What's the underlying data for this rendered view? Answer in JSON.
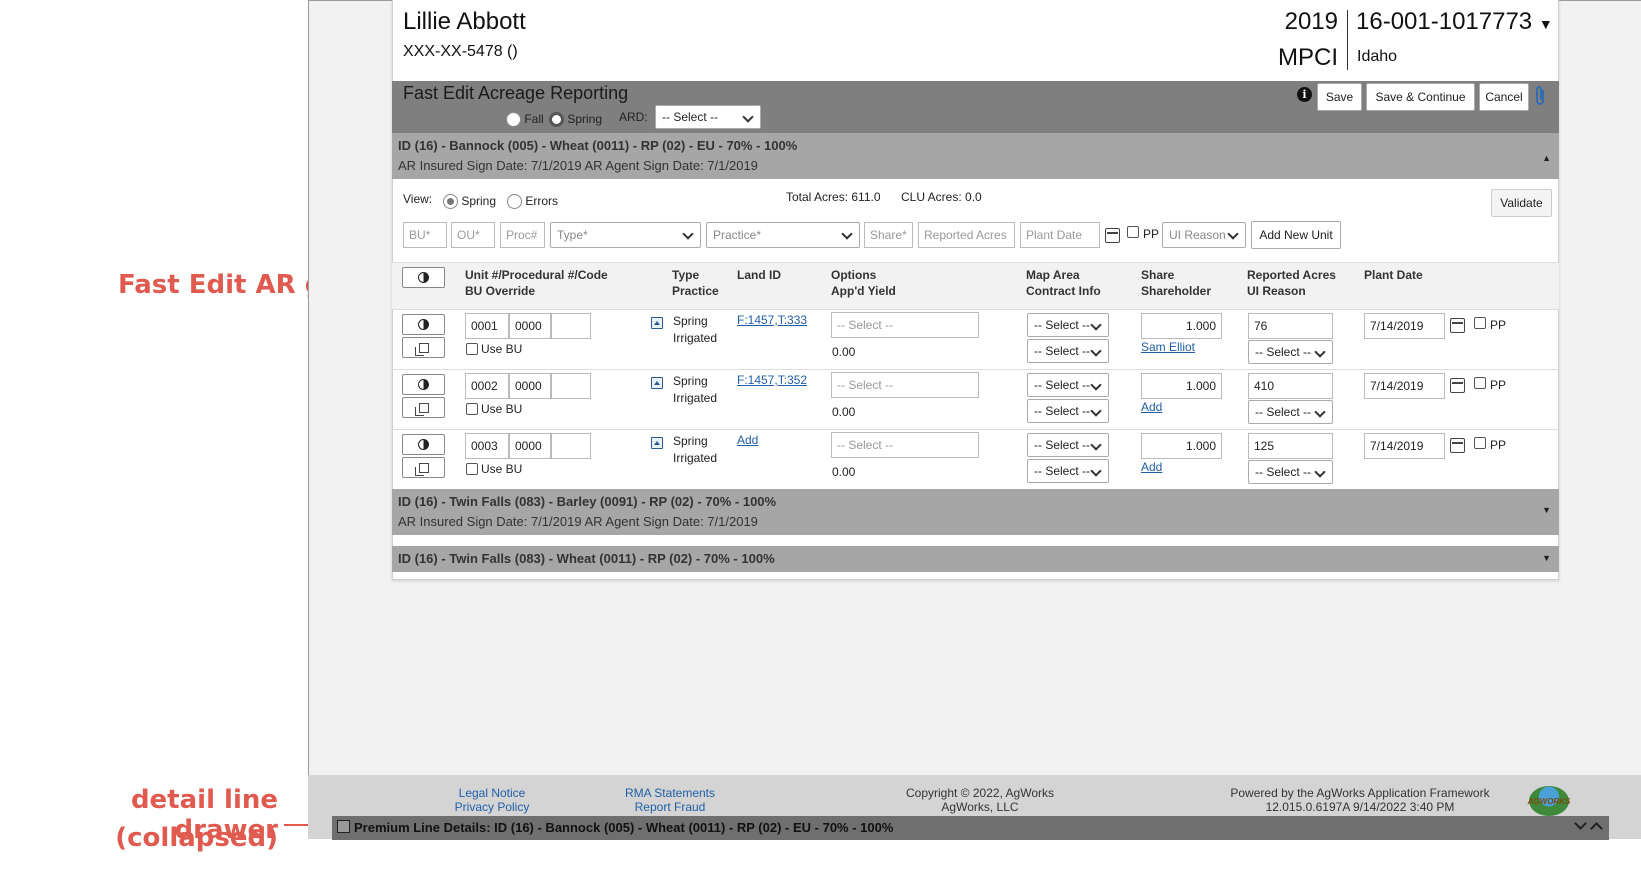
{
  "annotations": {
    "grid_label": "Fast Edit AR grid",
    "drawer_label_line1": "detail line drawer",
    "drawer_label_line2": "(collapsed)"
  },
  "header": {
    "customer_name": "Lillie Abbott",
    "customer_ssn": "XXX-XX-5478 ()",
    "crop_year": "2019",
    "plan": "MPCI",
    "policy_number": "16-001-1017773",
    "state": "Idaho"
  },
  "toolbar": {
    "title": "Fast Edit Acreage Reporting",
    "fall_label": "Fall",
    "spring_label": "Spring",
    "ard_label": "ARD:",
    "ard_select": "-- Select --",
    "save_label": "Save",
    "save_continue_label": "Save & Continue",
    "cancel_label": "Cancel"
  },
  "groups": [
    {
      "title": "ID (16) - Bannock (005) - Wheat (0011) - RP (02) - EU - 70% - 100%",
      "dates": "AR Insured Sign Date: 7/1/2019   AR Agent Sign Date: 7/1/2019",
      "expanded": true
    },
    {
      "title": "ID (16) - Twin Falls (083) - Barley (0091) - RP (02) - 70% - 100%",
      "dates": "AR Insured Sign Date: 7/1/2019   AR Agent Sign Date: 7/1/2019",
      "expanded": false
    },
    {
      "title": "ID (16) - Twin Falls (083) - Wheat (0011) - RP (02) - 70% - 100%",
      "expanded": false
    }
  ],
  "view_bar": {
    "view_label": "View:",
    "spring_label": "Spring",
    "errors_label": "Errors",
    "total_acres": "Total Acres:   611.0",
    "clu_acres": "CLU Acres:   0.0",
    "validate_label": "Validate"
  },
  "new_unit": {
    "bu": "BU*",
    "ou": "OU*",
    "proc": "Proc#",
    "type": "Type*",
    "practice": "Practice*",
    "share": "Share*",
    "reported_acres": "Reported Acres",
    "plant_date": "Plant Date",
    "pp": "PP",
    "ui_reason": "UI Reason",
    "add_button": "Add New Unit"
  },
  "columns": {
    "unit_1": "Unit #/Procedural #/Code",
    "unit_2": "BU Override",
    "type_1": "Type",
    "type_2": "Practice",
    "land_id": "Land ID",
    "options_1": "Options",
    "options_2": "App'd Yield",
    "map_1": "Map Area",
    "map_2": "Contract Info",
    "share_1": "Share",
    "share_2": "Shareholder",
    "acres_1": "Reported Acres",
    "acres_2": "UI Reason",
    "plant_date": "Plant Date"
  },
  "rows": [
    {
      "unit": "0001",
      "proc": "0000",
      "use_bu": "Use BU",
      "type": "Spring",
      "practice": "Irrigated",
      "land_id": "F:1457,T:333",
      "options": "-- Select --",
      "yield": "0.00",
      "map_area": "-- Select --",
      "contract": "-- Select --",
      "share": "1.000",
      "shareholder": "Sam Elliot",
      "acres": "76",
      "ui_reason": "-- Select --",
      "plant_date": "7/14/2019",
      "pp": "PP"
    },
    {
      "unit": "0002",
      "proc": "0000",
      "use_bu": "Use BU",
      "type": "Spring",
      "practice": "Irrigated",
      "land_id": "F:1457,T:352",
      "options": "-- Select --",
      "yield": "0.00",
      "map_area": "-- Select --",
      "contract": "-- Select --",
      "share": "1.000",
      "shareholder": "Add",
      "acres": "410",
      "ui_reason": "-- Select --",
      "plant_date": "7/14/2019",
      "pp": "PP"
    },
    {
      "unit": "0003",
      "proc": "0000",
      "use_bu": "Use BU",
      "type": "Spring",
      "practice": "Irrigated",
      "land_id": "Add",
      "options": "-- Select --",
      "yield": "0.00",
      "map_area": "-- Select --",
      "contract": "-- Select --",
      "share": "1.000",
      "shareholder": "Add",
      "acres": "125",
      "ui_reason": "-- Select --",
      "plant_date": "7/14/2019",
      "pp": "PP"
    }
  ],
  "footer": {
    "legal_notice": "Legal Notice",
    "privacy_policy": "Privacy Policy",
    "rma_statements": "RMA Statements",
    "report_fraud": "Report Fraud",
    "copyright": "Copyright © 2022, AgWorks",
    "company": "AgWorks, LLC",
    "powered_by": "Powered by the AgWorks Application Framework",
    "version": "12.015.0.6197A 9/14/2022 3:40 PM",
    "logo_text": "AGWORKS"
  },
  "drawer": {
    "title": "Premium Line Details: ID (16) - Bannock (005) - Wheat (0011) - RP (02) - EU - 70% - 100%"
  },
  "colors": {
    "annotation": "#e05a4f",
    "toolbar_bg": "#7f7f7f",
    "group_header_bg": "#a6a6a6",
    "link": "#1f5fa8"
  }
}
